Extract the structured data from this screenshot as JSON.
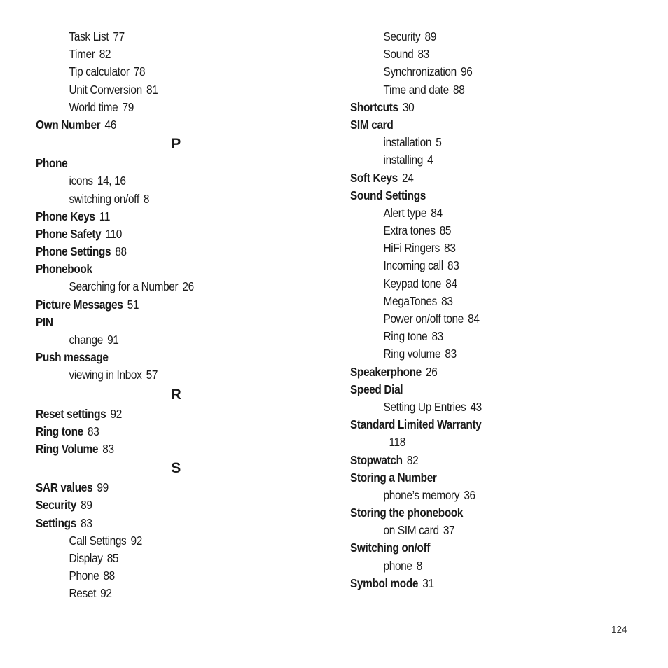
{
  "page_number": "124",
  "left_column": [
    {
      "type": "sub",
      "term": "Task List",
      "pages": "77"
    },
    {
      "type": "sub",
      "term": "Timer",
      "pages": "82"
    },
    {
      "type": "sub",
      "term": "Tip calculator",
      "pages": "78"
    },
    {
      "type": "sub",
      "term": "Unit Conversion",
      "pages": "81"
    },
    {
      "type": "sub",
      "term": "World time",
      "pages": "79"
    },
    {
      "type": "main",
      "term": "Own Number",
      "pages": "46"
    },
    {
      "type": "letter",
      "term": "P"
    },
    {
      "type": "main",
      "term": "Phone",
      "pages": ""
    },
    {
      "type": "sub",
      "term": "icons",
      "pages": "14, 16"
    },
    {
      "type": "sub",
      "term": "switching on/off",
      "pages": "8"
    },
    {
      "type": "main",
      "term": "Phone Keys",
      "pages": "11"
    },
    {
      "type": "main",
      "term": "Phone Safety",
      "pages": "110"
    },
    {
      "type": "main",
      "term": "Phone Settings",
      "pages": "88"
    },
    {
      "type": "main",
      "term": "Phonebook",
      "pages": ""
    },
    {
      "type": "sub",
      "term": "Searching for a Number",
      "pages": "26"
    },
    {
      "type": "main",
      "term": "Picture Messages",
      "pages": "51"
    },
    {
      "type": "main",
      "term": "PIN",
      "pages": ""
    },
    {
      "type": "sub",
      "term": "change",
      "pages": "91"
    },
    {
      "type": "main",
      "term": "Push message",
      "pages": ""
    },
    {
      "type": "sub",
      "term": "viewing in Inbox",
      "pages": "57"
    },
    {
      "type": "letter",
      "term": "R"
    },
    {
      "type": "main",
      "term": "Reset settings",
      "pages": "92"
    },
    {
      "type": "main",
      "term": "Ring tone",
      "pages": "83"
    },
    {
      "type": "main",
      "term": "Ring Volume",
      "pages": "83"
    },
    {
      "type": "letter",
      "term": "S"
    },
    {
      "type": "main",
      "term": "SAR values",
      "pages": "99"
    },
    {
      "type": "main",
      "term": "Security",
      "pages": "89"
    },
    {
      "type": "main",
      "term": "Settings",
      "pages": "83"
    },
    {
      "type": "sub",
      "term": "Call Settings",
      "pages": "92"
    },
    {
      "type": "sub",
      "term": "Display",
      "pages": "85"
    },
    {
      "type": "sub",
      "term": "Phone",
      "pages": "88"
    },
    {
      "type": "sub",
      "term": "Reset",
      "pages": "92"
    }
  ],
  "right_column": [
    {
      "type": "sub",
      "term": "Security",
      "pages": "89"
    },
    {
      "type": "sub",
      "term": "Sound",
      "pages": "83"
    },
    {
      "type": "sub",
      "term": "Synchronization",
      "pages": "96"
    },
    {
      "type": "sub",
      "term": "Time and date",
      "pages": "88"
    },
    {
      "type": "main",
      "term": "Shortcuts",
      "pages": "30"
    },
    {
      "type": "main",
      "term": "SIM card",
      "pages": ""
    },
    {
      "type": "sub",
      "term": "installation",
      "pages": "5"
    },
    {
      "type": "sub",
      "term": "installing",
      "pages": "4"
    },
    {
      "type": "main",
      "term": "Soft Keys",
      "pages": "24"
    },
    {
      "type": "main",
      "term": "Sound Settings",
      "pages": ""
    },
    {
      "type": "sub",
      "term": "Alert type",
      "pages": "84"
    },
    {
      "type": "sub",
      "term": "Extra tones",
      "pages": "85"
    },
    {
      "type": "sub",
      "term": "HiFi Ringers",
      "pages": "83"
    },
    {
      "type": "sub",
      "term": "Incoming call",
      "pages": "83"
    },
    {
      "type": "sub",
      "term": "Keypad tone",
      "pages": "84"
    },
    {
      "type": "sub",
      "term": "MegaTones",
      "pages": "83"
    },
    {
      "type": "sub",
      "term": "Power on/off tone",
      "pages": "84"
    },
    {
      "type": "sub",
      "term": "Ring tone",
      "pages": "83"
    },
    {
      "type": "sub",
      "term": "Ring volume",
      "pages": "83"
    },
    {
      "type": "main",
      "term": "Speakerphone",
      "pages": "26"
    },
    {
      "type": "main",
      "term": "Speed Dial",
      "pages": ""
    },
    {
      "type": "sub",
      "term": "Setting Up Entries",
      "pages": "43"
    },
    {
      "type": "main",
      "term": "Standard Limited Warranty",
      "pages": ""
    },
    {
      "type": "cont",
      "term": "",
      "pages": "118"
    },
    {
      "type": "main",
      "term": "Stopwatch",
      "pages": "82"
    },
    {
      "type": "main",
      "term": "Storing a Number",
      "pages": ""
    },
    {
      "type": "sub",
      "term": "phone’s memory",
      "pages": "36"
    },
    {
      "type": "main",
      "term": "Storing the phonebook",
      "pages": ""
    },
    {
      "type": "sub",
      "term": "on SIM card",
      "pages": "37"
    },
    {
      "type": "main",
      "term": "Switching on/off",
      "pages": ""
    },
    {
      "type": "sub",
      "term": "phone",
      "pages": "8"
    },
    {
      "type": "main",
      "term": "Symbol mode",
      "pages": "31"
    }
  ]
}
